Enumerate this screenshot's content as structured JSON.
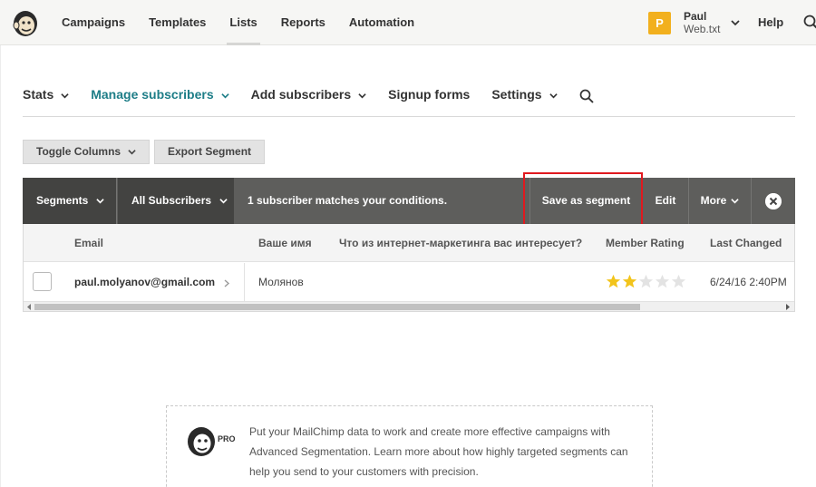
{
  "topnav": {
    "items": [
      {
        "label": "Campaigns"
      },
      {
        "label": "Templates"
      },
      {
        "label": "Lists"
      },
      {
        "label": "Reports"
      },
      {
        "label": "Automation"
      }
    ],
    "active": "Lists",
    "account": {
      "badge": "P",
      "name": "Paul",
      "org": "Web.txt",
      "badge_color": "#f2b01e"
    },
    "help_label": "Help"
  },
  "subnav": {
    "items": [
      {
        "label": "Stats"
      },
      {
        "label": "Manage subscribers"
      },
      {
        "label": "Add subscribers"
      },
      {
        "label": "Signup forms"
      },
      {
        "label": "Settings"
      }
    ],
    "active": "Manage subscribers",
    "accent_color": "#1d7d87"
  },
  "toolbar": {
    "toggle_columns_label": "Toggle Columns",
    "export_segment_label": "Export Segment"
  },
  "segment_bar": {
    "segments_label": "Segments",
    "all_subscribers_label": "All Subscribers",
    "match_text": "1 subscriber matches your conditions.",
    "save_label": "Save as segment",
    "edit_label": "Edit",
    "more_label": "More",
    "highlight_color": "#e0191f"
  },
  "table": {
    "columns": [
      "Email",
      "Ваше имя",
      "Что из интернет-маркетинга вас интересует?",
      "Member Rating",
      "Last Changed"
    ],
    "rows": [
      {
        "email": "paul.molyanov@gmail.com",
        "name": "Молянов",
        "interest": "",
        "rating": 2,
        "rating_max": 5,
        "last_changed": "6/24/16 2:40PM"
      }
    ],
    "scroll_fraction": 0.79
  },
  "promo": {
    "badge": "PRO",
    "text": "Put your MailChimp data to work and create more effective campaigns with Advanced Segmentation. Learn more about how highly targeted segments can help you send to your customers with precision."
  }
}
